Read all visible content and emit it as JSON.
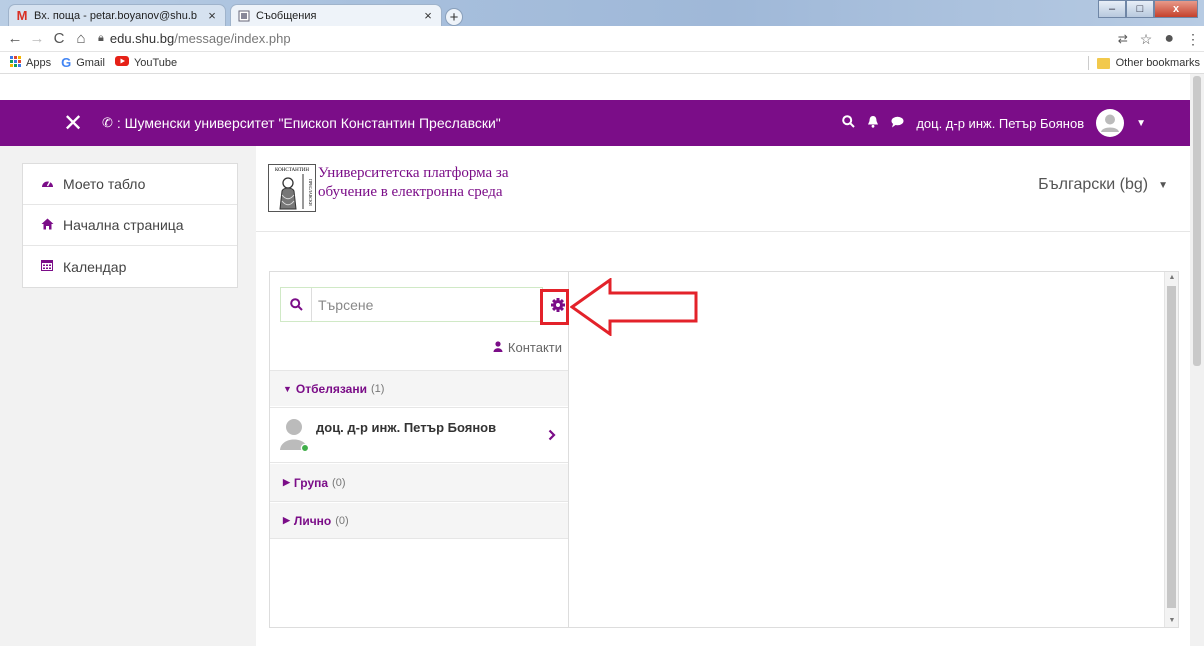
{
  "browser": {
    "tabs": [
      {
        "title": "Вх. поща - petar.boyanov@shu.b",
        "favicon": "gmail-icon",
        "active": false
      },
      {
        "title": "Съобщения",
        "favicon": "page-icon",
        "active": true
      }
    ],
    "close_glyph": "×",
    "url_host": "edu.shu.bg",
    "url_path": "/message/index.php",
    "bookmarks": [
      {
        "label": "Apps",
        "icon": "apps-grid-icon"
      },
      {
        "label": "Gmail",
        "icon": "google-g-icon"
      },
      {
        "label": "YouTube",
        "icon": "youtube-icon"
      }
    ],
    "other_bookmarks": "Other bookmarks"
  },
  "header": {
    "org": ": Шуменски университет \"Епископ Константин Преславски\"",
    "user_name": "доц. д-р инж. Петър Боянов",
    "accent": "#7b0d88"
  },
  "nav": {
    "items": [
      {
        "label": "Моето табло",
        "icon": "dashboard-icon"
      },
      {
        "label": "Начална страница",
        "icon": "home-icon"
      },
      {
        "label": "Календар",
        "icon": "calendar-icon"
      }
    ]
  },
  "brand": {
    "line1": "Университетска платформа за",
    "line2": "обучение в електронна среда",
    "logo_text": "КОНСТАНТИН ПРЕСЛАВСКИ"
  },
  "language": "Български (bg)",
  "messages": {
    "search_placeholder": "Търсене",
    "contacts_label": "Контакти",
    "sections": [
      {
        "label": "Отбелязани",
        "count": "(1)",
        "expanded": true
      },
      {
        "label": "Група",
        "count": "(0)",
        "expanded": false
      },
      {
        "label": "Лично",
        "count": "(0)",
        "expanded": false
      }
    ],
    "starred_contact": {
      "name": "доц. д-р инж. Петър Боянов",
      "online": true
    }
  },
  "annotation_color": "#e3222a"
}
